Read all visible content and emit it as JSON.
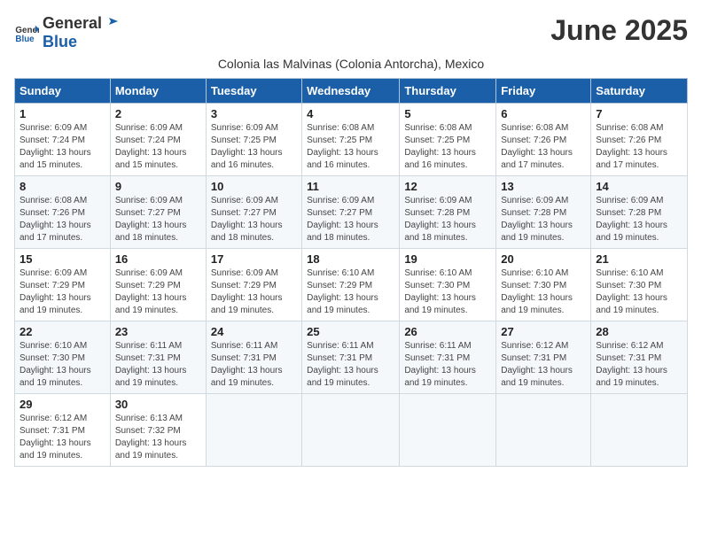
{
  "logo": {
    "general": "General",
    "blue": "Blue"
  },
  "title": "June 2025",
  "subtitle": "Colonia las Malvinas (Colonia Antorcha), Mexico",
  "days_header": [
    "Sunday",
    "Monday",
    "Tuesday",
    "Wednesday",
    "Thursday",
    "Friday",
    "Saturday"
  ],
  "weeks": [
    [
      {
        "day": "1",
        "info": "Sunrise: 6:09 AM\nSunset: 7:24 PM\nDaylight: 13 hours and 15 minutes."
      },
      {
        "day": "2",
        "info": "Sunrise: 6:09 AM\nSunset: 7:24 PM\nDaylight: 13 hours and 15 minutes."
      },
      {
        "day": "3",
        "info": "Sunrise: 6:09 AM\nSunset: 7:25 PM\nDaylight: 13 hours and 16 minutes."
      },
      {
        "day": "4",
        "info": "Sunrise: 6:08 AM\nSunset: 7:25 PM\nDaylight: 13 hours and 16 minutes."
      },
      {
        "day": "5",
        "info": "Sunrise: 6:08 AM\nSunset: 7:25 PM\nDaylight: 13 hours and 16 minutes."
      },
      {
        "day": "6",
        "info": "Sunrise: 6:08 AM\nSunset: 7:26 PM\nDaylight: 13 hours and 17 minutes."
      },
      {
        "day": "7",
        "info": "Sunrise: 6:08 AM\nSunset: 7:26 PM\nDaylight: 13 hours and 17 minutes."
      }
    ],
    [
      {
        "day": "8",
        "info": "Sunrise: 6:08 AM\nSunset: 7:26 PM\nDaylight: 13 hours and 17 minutes."
      },
      {
        "day": "9",
        "info": "Sunrise: 6:09 AM\nSunset: 7:27 PM\nDaylight: 13 hours and 18 minutes."
      },
      {
        "day": "10",
        "info": "Sunrise: 6:09 AM\nSunset: 7:27 PM\nDaylight: 13 hours and 18 minutes."
      },
      {
        "day": "11",
        "info": "Sunrise: 6:09 AM\nSunset: 7:27 PM\nDaylight: 13 hours and 18 minutes."
      },
      {
        "day": "12",
        "info": "Sunrise: 6:09 AM\nSunset: 7:28 PM\nDaylight: 13 hours and 18 minutes."
      },
      {
        "day": "13",
        "info": "Sunrise: 6:09 AM\nSunset: 7:28 PM\nDaylight: 13 hours and 19 minutes."
      },
      {
        "day": "14",
        "info": "Sunrise: 6:09 AM\nSunset: 7:28 PM\nDaylight: 13 hours and 19 minutes."
      }
    ],
    [
      {
        "day": "15",
        "info": "Sunrise: 6:09 AM\nSunset: 7:29 PM\nDaylight: 13 hours and 19 minutes."
      },
      {
        "day": "16",
        "info": "Sunrise: 6:09 AM\nSunset: 7:29 PM\nDaylight: 13 hours and 19 minutes."
      },
      {
        "day": "17",
        "info": "Sunrise: 6:09 AM\nSunset: 7:29 PM\nDaylight: 13 hours and 19 minutes."
      },
      {
        "day": "18",
        "info": "Sunrise: 6:10 AM\nSunset: 7:29 PM\nDaylight: 13 hours and 19 minutes."
      },
      {
        "day": "19",
        "info": "Sunrise: 6:10 AM\nSunset: 7:30 PM\nDaylight: 13 hours and 19 minutes."
      },
      {
        "day": "20",
        "info": "Sunrise: 6:10 AM\nSunset: 7:30 PM\nDaylight: 13 hours and 19 minutes."
      },
      {
        "day": "21",
        "info": "Sunrise: 6:10 AM\nSunset: 7:30 PM\nDaylight: 13 hours and 19 minutes."
      }
    ],
    [
      {
        "day": "22",
        "info": "Sunrise: 6:10 AM\nSunset: 7:30 PM\nDaylight: 13 hours and 19 minutes."
      },
      {
        "day": "23",
        "info": "Sunrise: 6:11 AM\nSunset: 7:31 PM\nDaylight: 13 hours and 19 minutes."
      },
      {
        "day": "24",
        "info": "Sunrise: 6:11 AM\nSunset: 7:31 PM\nDaylight: 13 hours and 19 minutes."
      },
      {
        "day": "25",
        "info": "Sunrise: 6:11 AM\nSunset: 7:31 PM\nDaylight: 13 hours and 19 minutes."
      },
      {
        "day": "26",
        "info": "Sunrise: 6:11 AM\nSunset: 7:31 PM\nDaylight: 13 hours and 19 minutes."
      },
      {
        "day": "27",
        "info": "Sunrise: 6:12 AM\nSunset: 7:31 PM\nDaylight: 13 hours and 19 minutes."
      },
      {
        "day": "28",
        "info": "Sunrise: 6:12 AM\nSunset: 7:31 PM\nDaylight: 13 hours and 19 minutes."
      }
    ],
    [
      {
        "day": "29",
        "info": "Sunrise: 6:12 AM\nSunset: 7:31 PM\nDaylight: 13 hours and 19 minutes."
      },
      {
        "day": "30",
        "info": "Sunrise: 6:13 AM\nSunset: 7:32 PM\nDaylight: 13 hours and 19 minutes."
      },
      null,
      null,
      null,
      null,
      null
    ]
  ]
}
